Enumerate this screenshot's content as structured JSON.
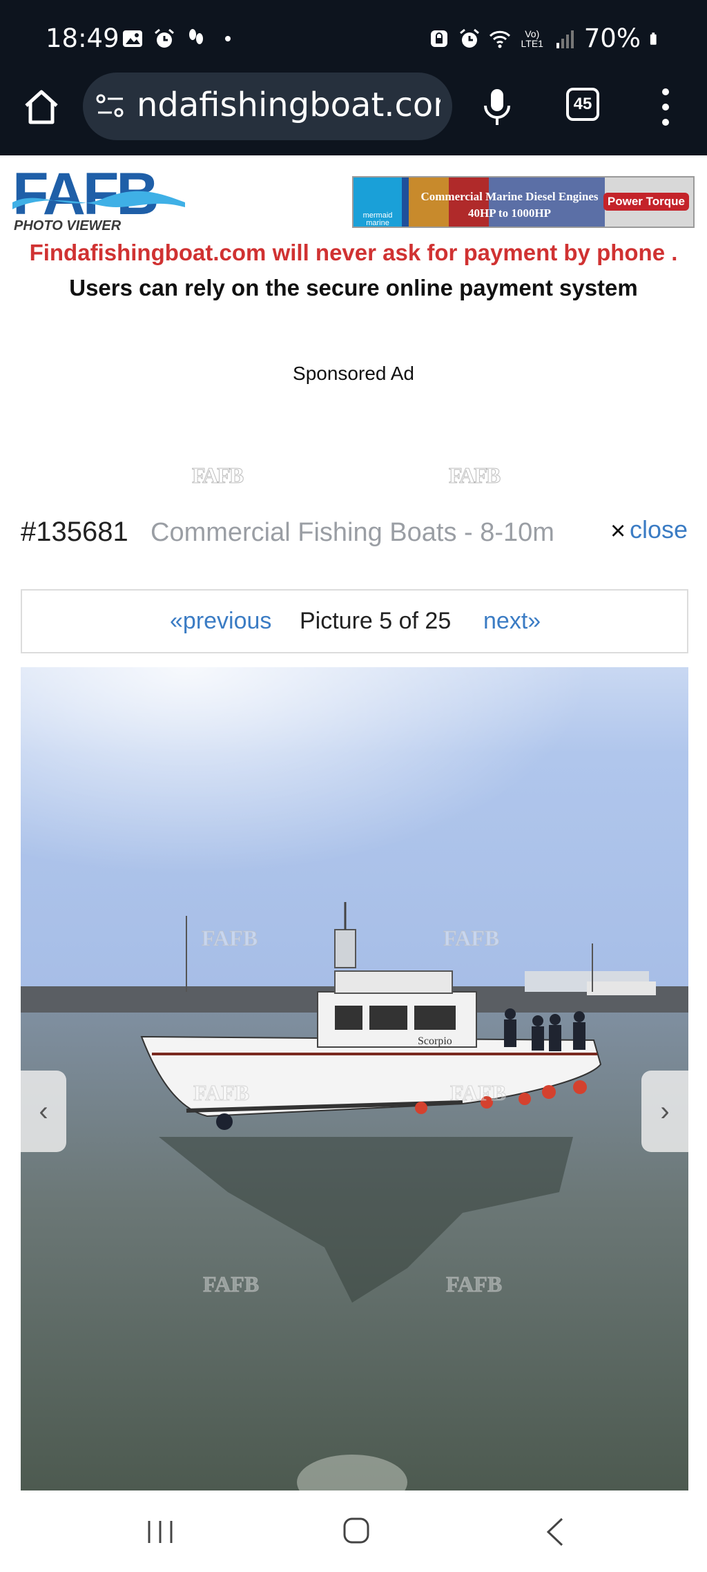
{
  "status_bar": {
    "time": "18:49",
    "battery": "70%",
    "icons_left": [
      "gallery-icon",
      "alarm-icon",
      "steps-icon",
      "dot-icon"
    ],
    "icons_right": [
      "lock-icon",
      "alarm-icon",
      "wifi-icon",
      "volte-icon",
      "signal-icon",
      "battery-icon"
    ],
    "network": "Vo) LTE1"
  },
  "browser": {
    "url": "ndafishingboat.com",
    "tab_count": "45"
  },
  "header": {
    "logo_text": "FAFB",
    "logo_sub": "PHOTO VIEWER",
    "banner": {
      "left": "mermaid marine",
      "line1": "Commercial Marine Diesel Engines",
      "line2": "40HP to 1000HP",
      "right": "Power Torque"
    }
  },
  "notice": {
    "warning": "Findafishingboat.com will never ask for payment by phone .",
    "secure": "Users can rely on the secure online payment system"
  },
  "ad": {
    "label": "Sponsored Ad"
  },
  "watermark": "FAFB",
  "viewer": {
    "listing_id": "#135681",
    "category": "Commercial Fishing Boats - 8-10m",
    "close_x": "×",
    "close_label": "close",
    "prev_label": "«previous",
    "counter": "Picture 5 of 25",
    "next_label": "next»",
    "boat_name": "Scorpio",
    "arrow_left": "‹",
    "arrow_right": "›"
  },
  "colors": {
    "warning_red": "#d03232",
    "link_blue": "#3b7cc4",
    "bar_dark": "#0d141e"
  }
}
